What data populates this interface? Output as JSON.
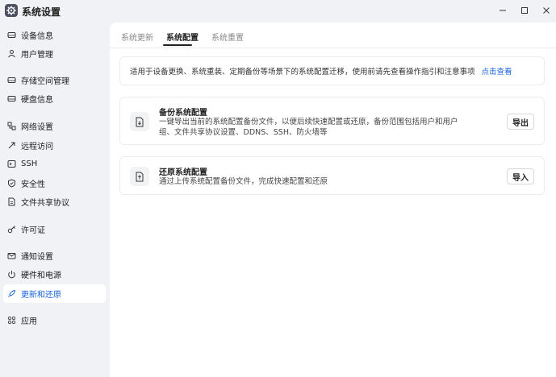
{
  "window": {
    "title": "系统设置",
    "app_icon": "gear-icon",
    "controls": [
      "minimize-icon",
      "maximize-icon",
      "close-icon"
    ]
  },
  "sidebar": {
    "items": [
      {
        "label": "设备信息",
        "icon": "drive-icon"
      },
      {
        "label": "用户管理",
        "icon": "user-icon"
      },
      {
        "label": "存储空间管理",
        "icon": "drive-icon"
      },
      {
        "label": "硬盘信息",
        "icon": "drive-icon"
      },
      {
        "label": "网络设置",
        "icon": "network-icon"
      },
      {
        "label": "远程访问",
        "icon": "remote-icon"
      },
      {
        "label": "SSH",
        "icon": "terminal-icon"
      },
      {
        "label": "安全性",
        "icon": "shield-icon"
      },
      {
        "label": "文件共享协议",
        "icon": "file-icon"
      },
      {
        "label": "许可证",
        "icon": "key-icon"
      },
      {
        "label": "通知设置",
        "icon": "mail-icon"
      },
      {
        "label": "硬件和电源",
        "icon": "power-icon"
      },
      {
        "label": "更新和还原",
        "icon": "rocket-icon",
        "active": true
      },
      {
        "label": "应用",
        "icon": "apps-icon"
      }
    ]
  },
  "tabs": [
    {
      "label": "系统更新"
    },
    {
      "label": "系统配置",
      "active": true
    },
    {
      "label": "系统重置"
    }
  ],
  "notice": {
    "text": "适用于设备更换、系统重装、定期备份等场景下的系统配置迁移，使用前请先查看操作指引和注意事项",
    "link": "点击查看"
  },
  "cards": {
    "backup": {
      "icon": "file-download-icon",
      "title": "备份系统配置",
      "desc": "一键导出当前的系统配置备份文件，以便后续快速配置或还原，备份范围包括用户和用户组、文件共享协议设置、DDNS、SSH、防火墙等",
      "button": "导出"
    },
    "restore": {
      "icon": "file-upload-icon",
      "title": "还原系统配置",
      "desc": "通过上传系统配置备份文件，完成快速配置和还原",
      "button": "导入"
    }
  },
  "colors": {
    "accent": "#1a63d8",
    "background": "#f1f2f5",
    "panel": "#ffffff"
  }
}
